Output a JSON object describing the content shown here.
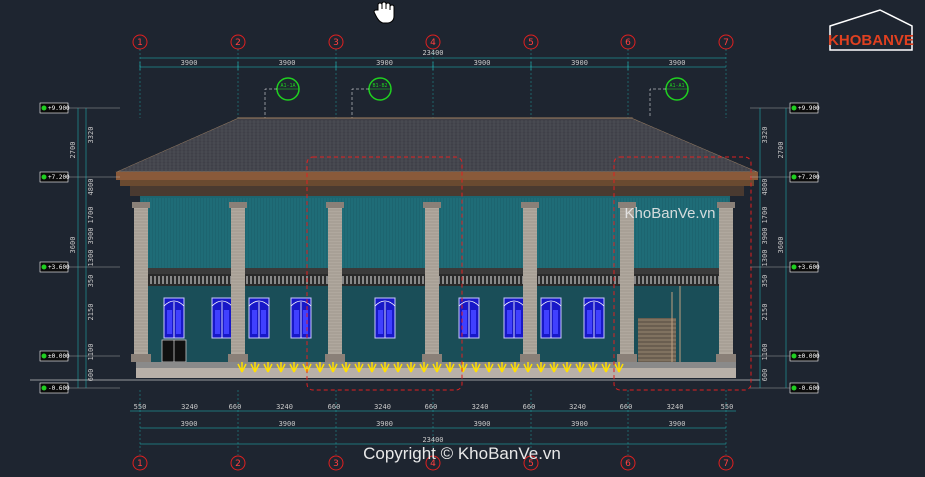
{
  "grid_top": [
    "1",
    "2",
    "3",
    "4",
    "5",
    "6",
    "7"
  ],
  "grid_bottom": [
    "1",
    "2",
    "3",
    "4",
    "5",
    "6",
    "7"
  ],
  "top_total": "23400",
  "top_spans": [
    "3900",
    "3900",
    "3900",
    "3900",
    "3900",
    "3900"
  ],
  "bottom_spans_a": [
    "550",
    "3240",
    "660",
    "3240",
    "660",
    "3240",
    "660",
    "3240",
    "660",
    "3240",
    "660",
    "3240",
    "550"
  ],
  "bottom_spans_b": [
    "3900",
    "3900",
    "3900",
    "3900",
    "3900",
    "3900"
  ],
  "bottom_total": "23400",
  "levels_left": [
    "+9.900",
    "+7.200",
    "+3.600",
    "±0.000",
    "-0.600"
  ],
  "levels_right": [
    "+9.900",
    "+7.200",
    "+3.600",
    "±0.000",
    "-0.600"
  ],
  "left_dims": [
    "2700",
    "3320",
    "4800",
    "1700",
    "3600",
    "3900",
    "1300",
    "350",
    "2150",
    "1100",
    "600"
  ],
  "right_dims": [
    "2700",
    "3320",
    "4800",
    "1700",
    "3600",
    "3900",
    "1300",
    "350",
    "2150",
    "1100",
    "600"
  ],
  "section_marks": [
    "A1-1A",
    "B1-B2",
    "A1-A1"
  ],
  "watermark_logo": "KHOBANVE",
  "watermark_mid": "KhoBanVe.vn",
  "copyright": "Copyright © KhoBanVe.vn",
  "colors": {
    "bg": "#1e2530",
    "roof": "#4a4a52",
    "column": "#b8b0a8",
    "glass": "#1f6a78",
    "window": "#2020d0",
    "red": "#e02020",
    "green": "#20d020",
    "cyan": "#20e0e0",
    "yellow": "#ffe000"
  }
}
